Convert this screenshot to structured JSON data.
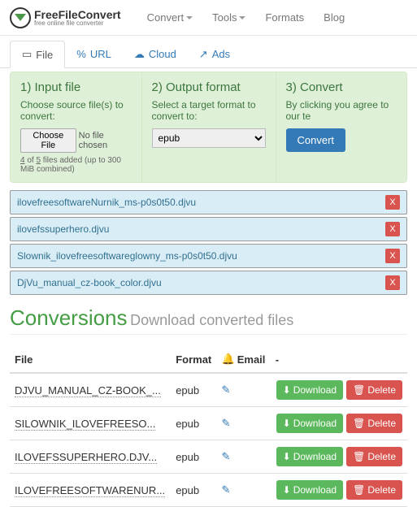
{
  "logo": {
    "name": "FreeFileConvert",
    "tag": "free online file converter"
  },
  "nav": [
    "Convert",
    "Tools",
    "Formats",
    "Blog"
  ],
  "tabs": [
    {
      "icon": "▭",
      "label": "File"
    },
    {
      "icon": "%",
      "label": "URL"
    },
    {
      "icon": "☁",
      "label": "Cloud"
    },
    {
      "icon": "↗",
      "label": "Ads"
    }
  ],
  "step1": {
    "title": "1) Input file",
    "desc": "Choose source file(s) to convert:",
    "btn": "Choose File",
    "txt": "No file chosen",
    "note_a": "4",
    "note_b": "5",
    "note_c": " files added (up to 300 MiB combined)"
  },
  "step2": {
    "title": "2) Output format",
    "desc": "Select a target format to convert to:",
    "value": "epub"
  },
  "step3": {
    "title": "3) Convert",
    "desc": "By clicking you agree to our te",
    "btn": "Convert"
  },
  "files": [
    "ilovefreesoftwareNurnik_ms-p0s0t50.djvu",
    "ilovefssuperhero.djvu",
    "Slownik_ilovefreesoftwareglowny_ms-p0s0t50.djvu",
    "DjVu_manual_cz-book_color.djvu"
  ],
  "conv": {
    "title": "Conversions",
    "sub": "Download converted files"
  },
  "th": {
    "file": "File",
    "format": "Format",
    "email": "Email",
    "dash": "-"
  },
  "rows": [
    {
      "file": "DJVU_MANUAL_CZ-BOOK_...",
      "format": "epub"
    },
    {
      "file": "SILOWNIK_ILOVEFREESO...",
      "format": "epub"
    },
    {
      "file": "ILOVEFSSUPERHERO.DJV...",
      "format": "epub"
    },
    {
      "file": "ILOVEFREESOFTWARENUR...",
      "format": "epub"
    }
  ],
  "btns": {
    "dl": "Download",
    "del": "Delete"
  }
}
